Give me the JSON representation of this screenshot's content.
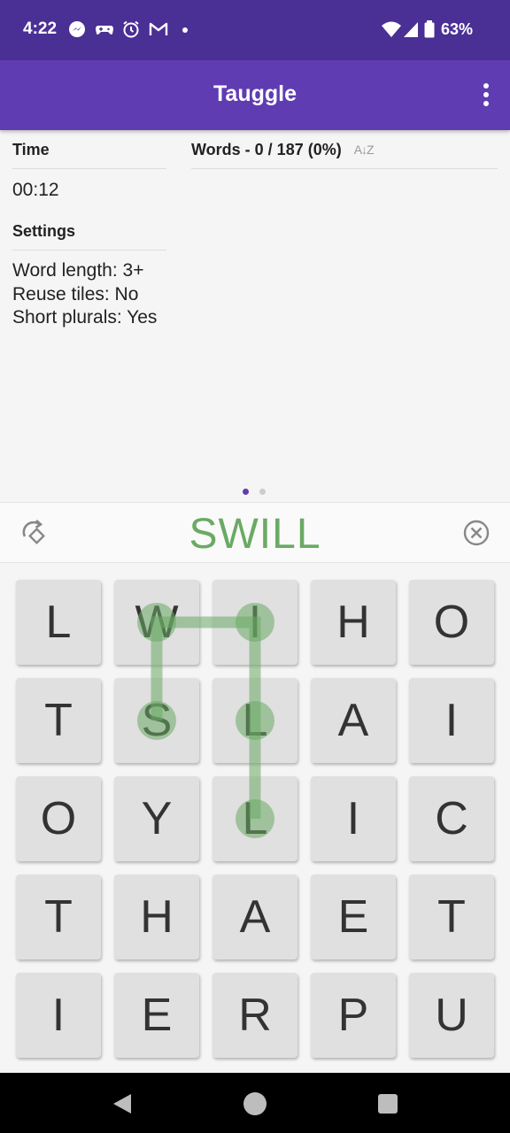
{
  "status_bar": {
    "time": "4:22",
    "battery": "63%",
    "icons": [
      "messenger-icon",
      "game-controller-icon",
      "alarm-icon",
      "gmail-icon",
      "wifi-icon",
      "signal-icon",
      "battery-icon"
    ]
  },
  "app_bar": {
    "title": "Tauggle",
    "menu_icon": "more-vert-icon"
  },
  "info": {
    "time_header": "Time",
    "time_value": "00:12",
    "settings_header": "Settings",
    "settings": [
      "Word length: 3+",
      "Reuse tiles: No",
      "Short plurals: Yes"
    ]
  },
  "words": {
    "header": "Words - 0 / 187 (0%)",
    "sort_icon": "A↓Z",
    "found": 0,
    "total": 187
  },
  "pager": {
    "pages": 2,
    "current": 0
  },
  "word_bar": {
    "current_word": "SWILL",
    "rotate_icon": "rotate-icon",
    "clear_icon": "clear-circle-icon"
  },
  "board": {
    "rows": [
      [
        "L",
        "W",
        "I",
        "H",
        "O"
      ],
      [
        "T",
        "S",
        "L",
        "A",
        "I"
      ],
      [
        "O",
        "Y",
        "L",
        "I",
        "C"
      ],
      [
        "T",
        "H",
        "A",
        "E",
        "T"
      ],
      [
        "I",
        "E",
        "R",
        "P",
        "U"
      ]
    ],
    "path": [
      [
        1,
        1
      ],
      [
        0,
        1
      ],
      [
        0,
        2
      ],
      [
        1,
        2
      ],
      [
        2,
        2
      ]
    ]
  },
  "colors": {
    "status_bar": "#4a2f95",
    "app_bar": "#603cb2",
    "accent_green": "#6aaa64",
    "tile": "#e0e0e0"
  },
  "nav_bar": {
    "buttons": [
      "back-icon",
      "home-icon",
      "recents-icon"
    ]
  }
}
